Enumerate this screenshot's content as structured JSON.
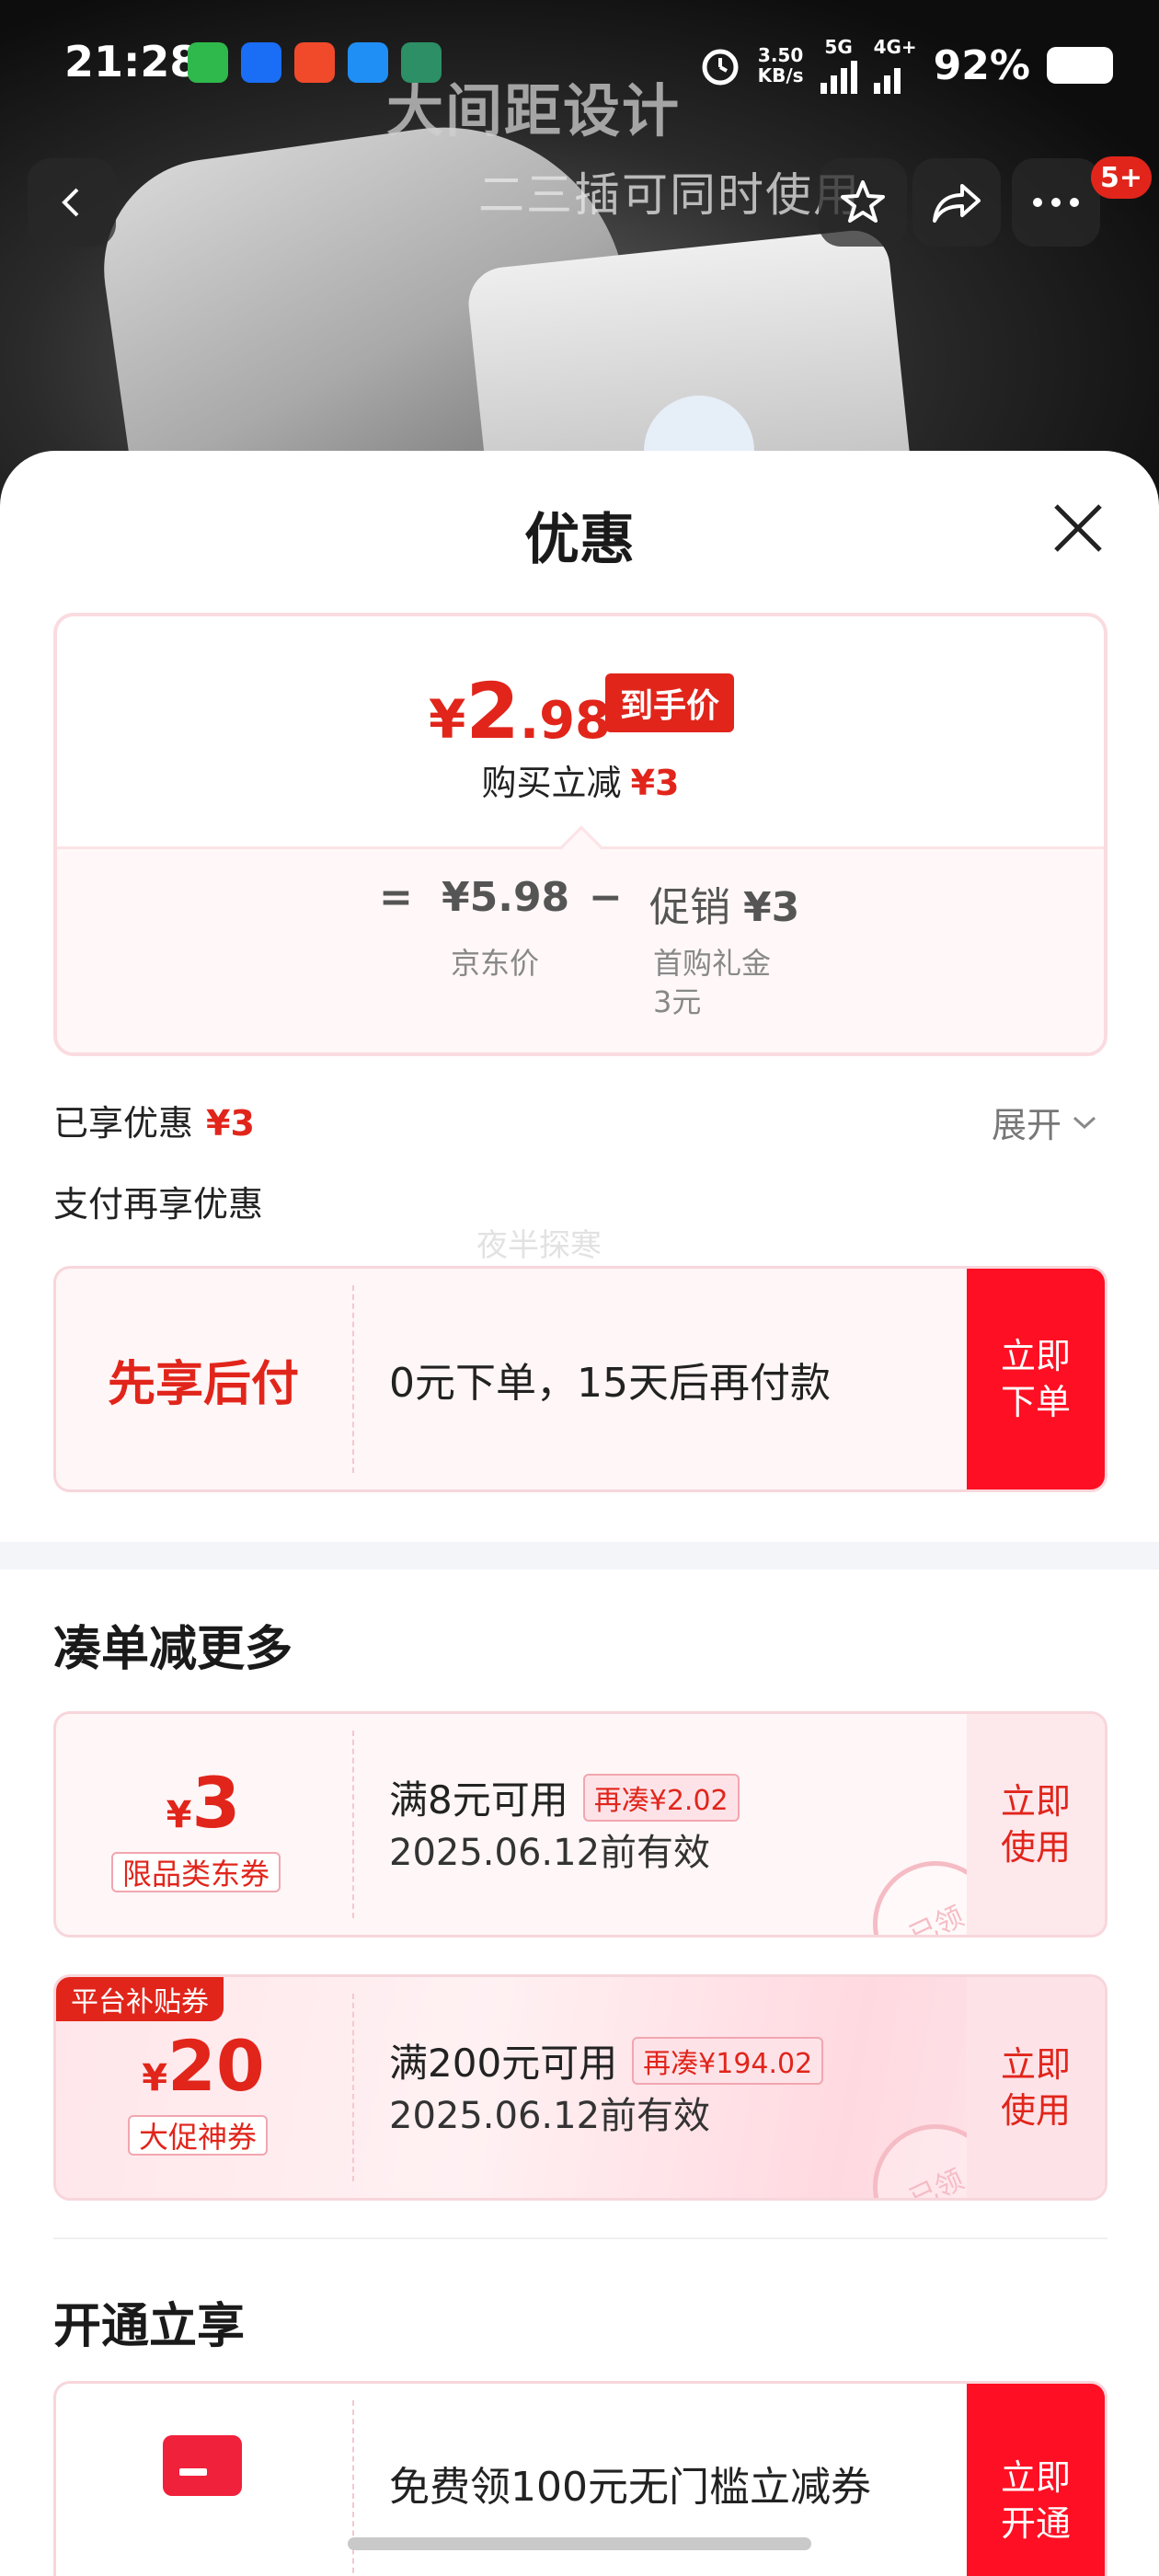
{
  "status_bar": {
    "time": "21:28",
    "net_speed": "3.50",
    "net_unit": "KB/s",
    "net_5g": "5G",
    "net_4g": "4G+",
    "battery": "92%"
  },
  "product_banner": {
    "headline": "大间距设计",
    "subline": "二三插可同时使用"
  },
  "nav": {
    "back_icon": "chevron-left-icon",
    "favorite_icon": "star-icon",
    "share_icon": "share-icon",
    "more_icon": "more-icon",
    "more_badge": "5+"
  },
  "sheet": {
    "title": "优惠"
  },
  "price_summary": {
    "currency": "¥",
    "final_integer": "2",
    "final_decimal": ".98",
    "final_tag": "到手价",
    "reduce_label": "购买立减",
    "reduce_amount": "¥3",
    "equals": "=",
    "jd_price": "¥5.98",
    "minus": "−",
    "promo_label": "促销",
    "promo_amount": "¥3",
    "jd_price_label": "京东价",
    "promo_detail_line1": "首购礼金",
    "promo_detail_line2": "3元"
  },
  "enjoyed": {
    "label": "已享优惠",
    "amount": "¥3",
    "expand_label": "展开"
  },
  "pay_more": {
    "label": "支付再享优惠"
  },
  "watermark": "夜半探寒",
  "bnpl": {
    "title": "先享后付",
    "desc": "0元下单，15天后再付款",
    "action_line1": "立即",
    "action_line2": "下单"
  },
  "section_more": {
    "title": "凑单减更多"
  },
  "coupons": [
    {
      "currency": "¥",
      "amount": "3",
      "type": "限品类东券",
      "condition": "满8元可用",
      "need_more": "再凑¥2.02",
      "valid": "2025.06.12前有效",
      "stamp": "已领",
      "action_line1": "立即",
      "action_line2": "使用"
    },
    {
      "corner_tag": "平台补贴券",
      "currency": "¥",
      "amount": "20",
      "type": "大促神券",
      "condition": "满200元可用",
      "need_more": "再凑¥194.02",
      "valid": "2025.06.12前有效",
      "stamp": "已领",
      "action_line1": "立即",
      "action_line2": "使用"
    }
  ],
  "section_open": {
    "title": "开通立享",
    "icon": "credit-card-icon",
    "desc": "免费领100元无门槛立减券",
    "action_line1": "立即",
    "action_line2": "开通"
  },
  "colors": {
    "brand_red": "#e1251b",
    "button_red": "#ff0f23",
    "card_bg": "#fff6f7",
    "card_border": "#f7d6db"
  }
}
